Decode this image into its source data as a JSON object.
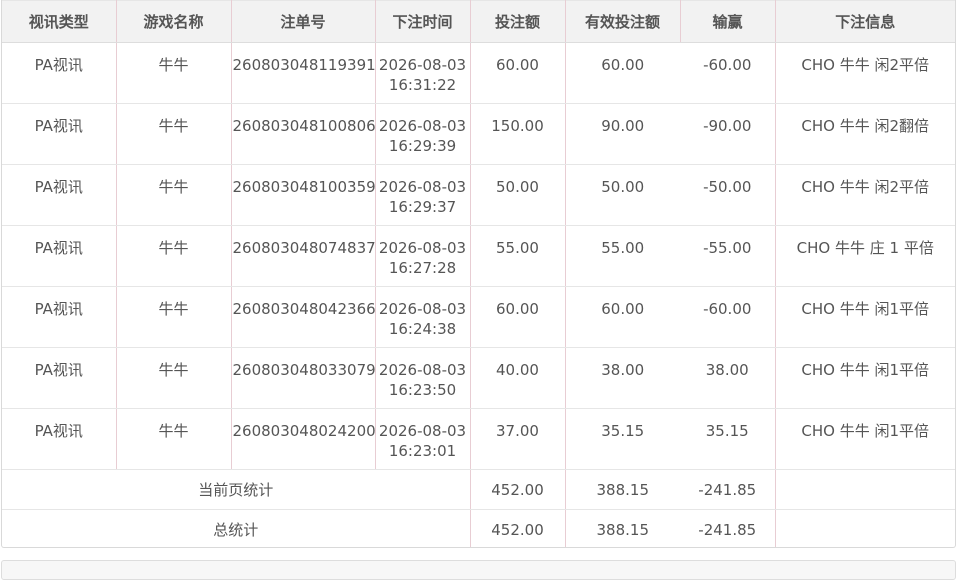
{
  "columns": [
    "视讯类型",
    "游戏名称",
    "注单号",
    "下注时间",
    "投注额",
    "有效投注额",
    "输赢",
    "下注信息"
  ],
  "rows": [
    {
      "type": "PA视讯",
      "game": "牛牛",
      "order": "260803048119391",
      "date": "2026-08-03",
      "time": "16:31:22",
      "bet": "60.00",
      "valid": "60.00",
      "win": "-60.00",
      "info": "CHO 牛牛 闲2平倍"
    },
    {
      "type": "PA视讯",
      "game": "牛牛",
      "order": "260803048100806",
      "date": "2026-08-03",
      "time": "16:29:39",
      "bet": "150.00",
      "valid": "90.00",
      "win": "-90.00",
      "info": "CHO 牛牛 闲2翻倍"
    },
    {
      "type": "PA视讯",
      "game": "牛牛",
      "order": "260803048100359",
      "date": "2026-08-03",
      "time": "16:29:37",
      "bet": "50.00",
      "valid": "50.00",
      "win": "-50.00",
      "info": "CHO 牛牛 闲2平倍"
    },
    {
      "type": "PA视讯",
      "game": "牛牛",
      "order": "260803048074837",
      "date": "2026-08-03",
      "time": "16:27:28",
      "bet": "55.00",
      "valid": "55.00",
      "win": "-55.00",
      "info": "CHO 牛牛 庄 1 平倍"
    },
    {
      "type": "PA视讯",
      "game": "牛牛",
      "order": "260803048042366",
      "date": "2026-08-03",
      "time": "16:24:38",
      "bet": "60.00",
      "valid": "60.00",
      "win": "-60.00",
      "info": "CHO 牛牛 闲1平倍"
    },
    {
      "type": "PA视讯",
      "game": "牛牛",
      "order": "260803048033079",
      "date": "2026-08-03",
      "time": "16:23:50",
      "bet": "40.00",
      "valid": "38.00",
      "win": "38.00",
      "info": "CHO 牛牛 闲1平倍"
    },
    {
      "type": "PA视讯",
      "game": "牛牛",
      "order": "260803048024200",
      "date": "2026-08-03",
      "time": "16:23:01",
      "bet": "37.00",
      "valid": "35.15",
      "win": "35.15",
      "info": "CHO 牛牛 闲1平倍"
    }
  ],
  "page_total": {
    "label": "当前页统计",
    "bet": "452.00",
    "valid": "388.15",
    "win": "-241.85"
  },
  "grand_total": {
    "label": "总统计",
    "bet": "452.00",
    "valid": "388.15",
    "win": "-241.85"
  }
}
